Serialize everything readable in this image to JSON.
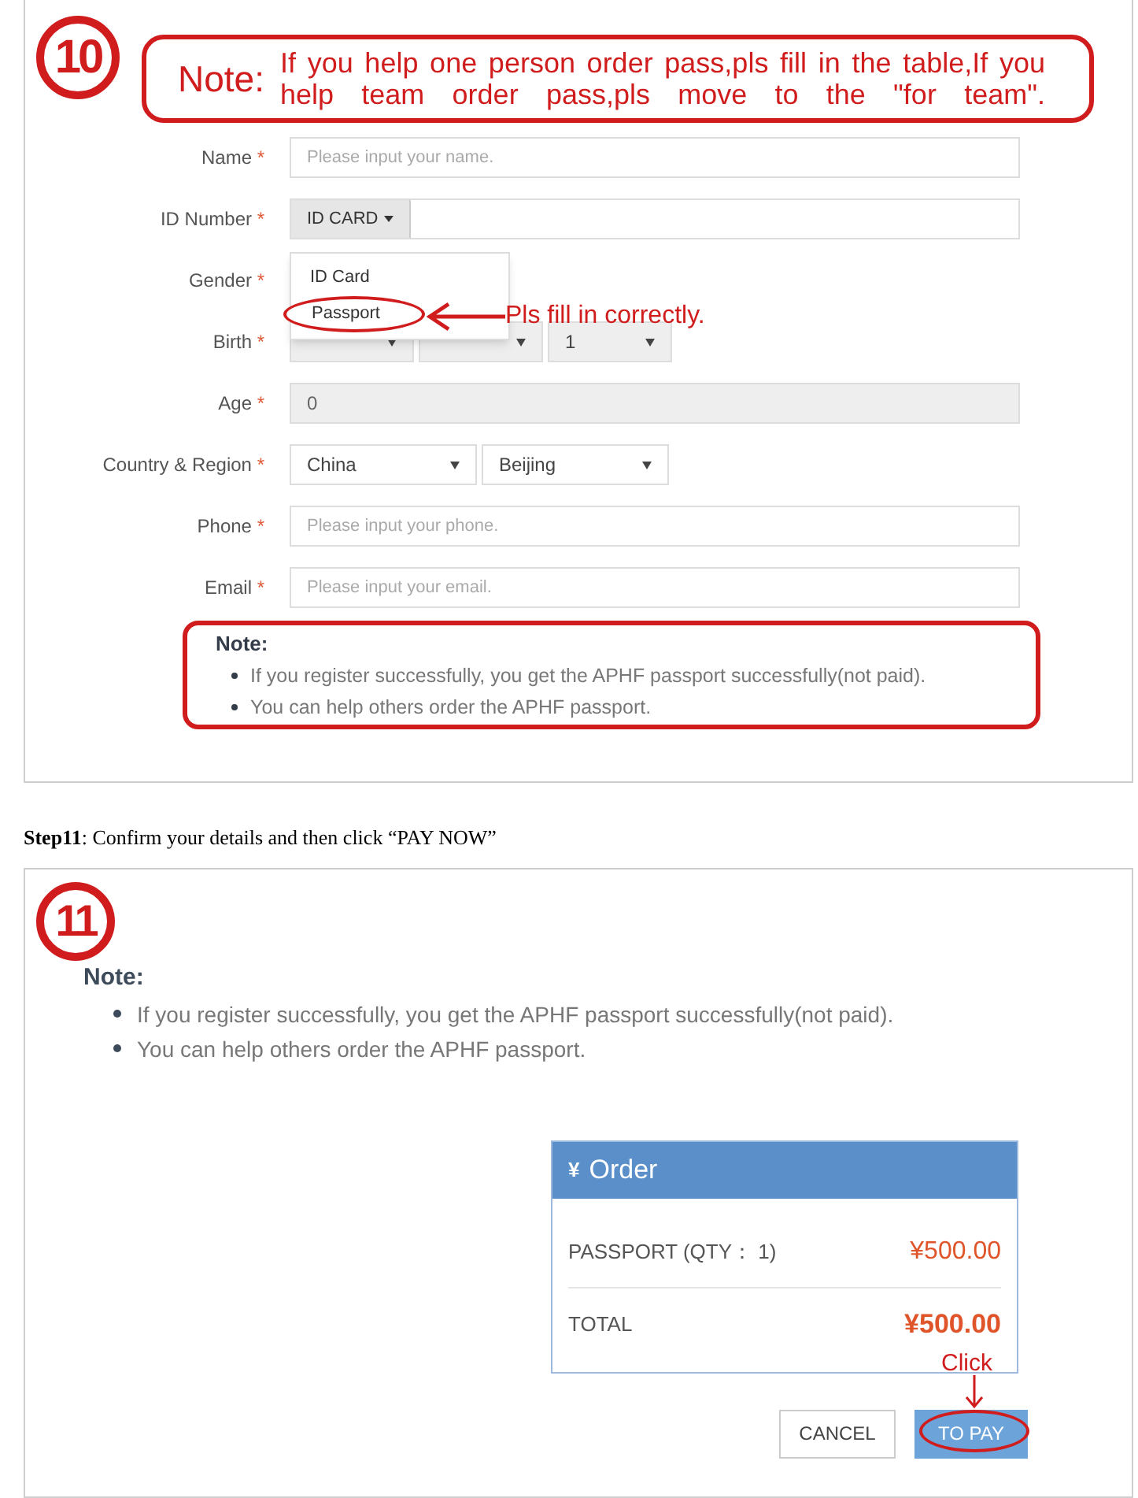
{
  "step10": {
    "badge": "10",
    "note": {
      "label": "Note:",
      "text": "If you help one person order pass,pls fill in the table,If you help team order pass,pls move to the \"for team\"."
    },
    "form": [
      {
        "kind": "text",
        "label": "Name",
        "required": "*",
        "placeholder": "Please input your name."
      },
      {
        "kind": "id",
        "label": "ID Number",
        "required": "*",
        "button": "ID CARD"
      },
      {
        "kind": "empty",
        "label": "Gender",
        "required": "*"
      },
      {
        "kind": "birth",
        "label": "Birth",
        "required": "*",
        "options": [
          "1"
        ]
      },
      {
        "kind": "readonly",
        "label": "Age",
        "required": "*",
        "value": "0"
      },
      {
        "kind": "selects",
        "label": "Country & Region",
        "required": "*",
        "options": [
          "China",
          "Beijing"
        ]
      },
      {
        "kind": "text",
        "label": "Phone",
        "required": "*",
        "placeholder": "Please input your phone."
      },
      {
        "kind": "text",
        "label": "Email",
        "required": "*",
        "placeholder": "Please input your email."
      }
    ],
    "id_menu": [
      {
        "label": "ID Card",
        "circled": false
      },
      {
        "label": "Passport",
        "circled": true
      }
    ],
    "annotation": "Pls fill in correctly.",
    "note_box": {
      "title": "Note:",
      "items": [
        "If you register successfully, you get the APHF passport successfully(not paid).",
        "You can help others order the APHF passport."
      ]
    }
  },
  "step11_caption": "**Step11**: Confirm your details and then click “PAY NOW”",
  "step11": {
    "badge": "11",
    "note_box": {
      "title": "Note:",
      "items": [
        "If you register successfully, you get the APHF passport successfully(not paid).",
        "You can help others order the APHF passport."
      ]
    },
    "order": {
      "currency": "¥",
      "title": "Order",
      "item": "PASSPORT (QTY： 1)",
      "item_price": "¥500.00",
      "total_label": "TOTAL",
      "total": "¥500.00"
    },
    "click_annotation": "Click",
    "buttons": [
      {
        "kind": "secondary",
        "label": "CANCEL"
      },
      {
        "kind": "primary",
        "label": "TO PAY"
      }
    ]
  }
}
